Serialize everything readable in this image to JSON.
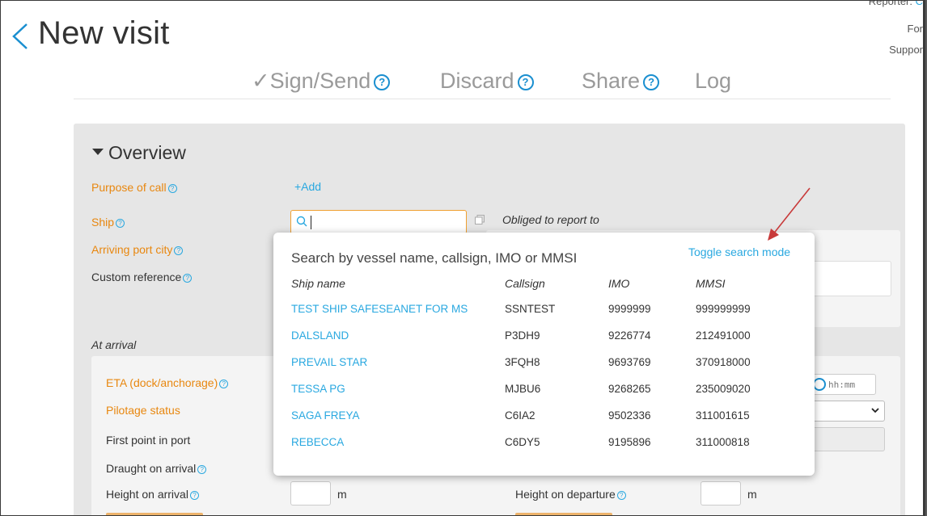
{
  "header": {
    "title": "New visit",
    "back_label": "back",
    "corner": {
      "reporter": "Reporter: ",
      "reporter_value": "C",
      "for": "For",
      "support": "Suppor"
    }
  },
  "actions": [
    {
      "check": "✓",
      "label": "Sign/Send",
      "help": "?"
    },
    {
      "label": "Discard",
      "help": "?"
    },
    {
      "label": "Share",
      "help": "?"
    },
    {
      "label": "Log"
    }
  ],
  "overview": {
    "title": "Overview",
    "purpose_of_call": "Purpose of call",
    "add": "+Add",
    "ship": "Ship",
    "obliged": "Obliged to report to",
    "arriving_port_city": "Arriving port city",
    "custom_reference": "Custom reference"
  },
  "arrival": {
    "title": "At arrival",
    "eta": "ETA (dock/anchorage)",
    "time_placeholder": "hh:mm",
    "pilotage_status": "Pilotage status",
    "first_point": "First point in port",
    "draught": "Draught on arrival",
    "height_arrival": "Height on arrival",
    "height_departure": "Height on departure",
    "unit_m": "m"
  },
  "search": {
    "prompt": "Search by vessel name, callsign, IMO or MMSI",
    "toggle": "Toggle search mode",
    "columns": [
      "Ship name",
      "Callsign",
      "IMO",
      "MMSI"
    ],
    "rows": [
      [
        "TEST SHIP SAFESEANET FOR MS",
        "SSNTEST",
        "9999999",
        "999999999"
      ],
      [
        "DALSLAND",
        "P3DH9",
        "9226774",
        "212491000"
      ],
      [
        "PREVAIL STAR",
        "3FQH8",
        "9693769",
        "370918000"
      ],
      [
        "TESSA PG",
        "MJBU6",
        "9268265",
        "235009020"
      ],
      [
        "SAGA FREYA",
        "C6IA2",
        "9502336",
        "311001615"
      ],
      [
        "REBECCA",
        "C6DY5",
        "9195896",
        "311000818"
      ]
    ]
  },
  "colors": {
    "accent": "#29a8e0",
    "required": "#e8870f",
    "annotation": "#d03030"
  }
}
